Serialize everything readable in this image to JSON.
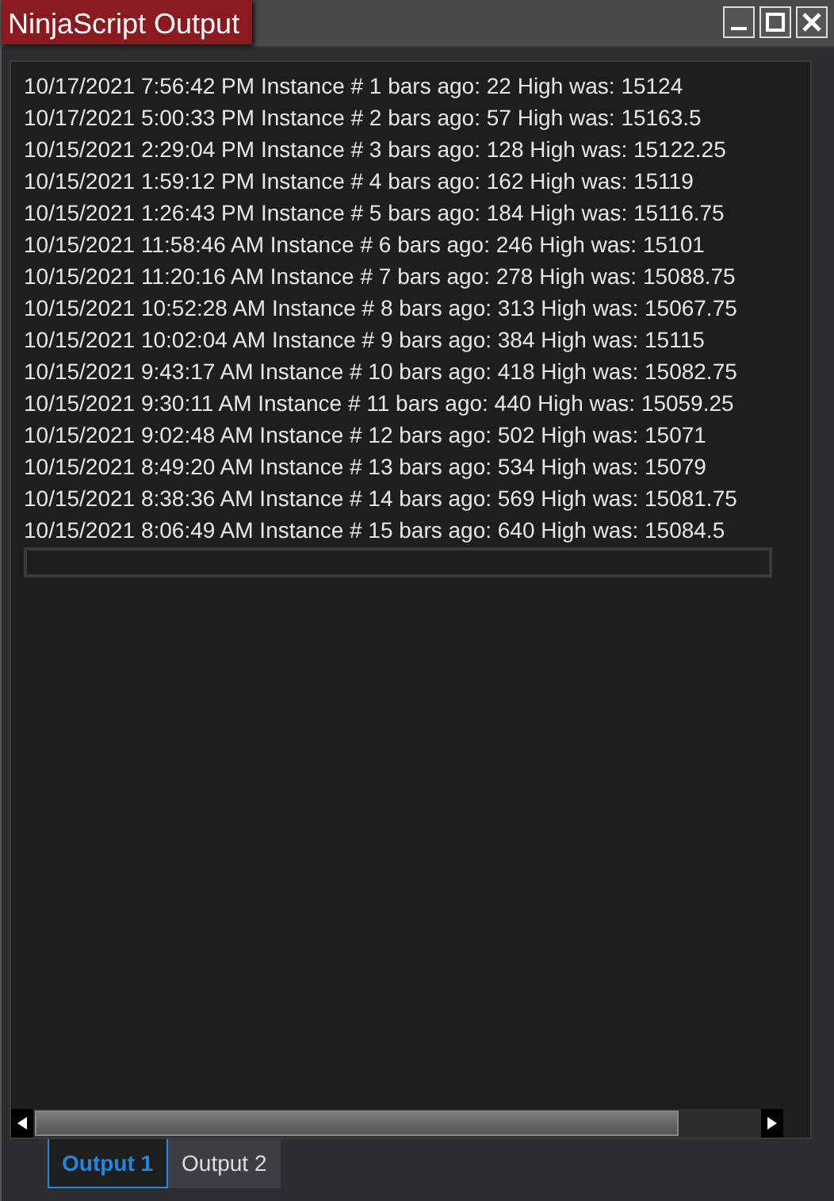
{
  "window": {
    "title": "NinjaScript Output"
  },
  "lines": [
    "10/17/2021 7:56:42 PM Instance # 1 bars ago: 22 High was: 15124",
    "10/17/2021 5:00:33 PM Instance # 2 bars ago: 57 High was: 15163.5",
    "10/15/2021 2:29:04 PM Instance # 3 bars ago: 128 High was: 15122.25",
    "10/15/2021 1:59:12 PM Instance # 4 bars ago: 162 High was: 15119",
    "10/15/2021 1:26:43 PM Instance # 5 bars ago: 184 High was: 15116.75",
    "10/15/2021 11:58:46 AM Instance # 6 bars ago: 246 High was: 15101",
    "10/15/2021 11:20:16 AM Instance # 7 bars ago: 278 High was: 15088.75",
    "10/15/2021 10:52:28 AM Instance # 8 bars ago: 313 High was: 15067.75",
    "10/15/2021 10:02:04 AM Instance # 9 bars ago: 384 High was: 15115",
    "10/15/2021 9:43:17 AM Instance # 10 bars ago: 418 High was: 15082.75",
    "10/15/2021 9:30:11 AM Instance # 11 bars ago: 440 High was: 15059.25",
    "10/15/2021 9:02:48 AM Instance # 12 bars ago: 502 High was: 15071",
    "10/15/2021 8:49:20 AM Instance # 13 bars ago: 534 High was: 15079",
    "10/15/2021 8:38:36 AM Instance # 14 bars ago: 569 High was: 15081.75",
    "10/15/2021 8:06:49 AM Instance # 15 bars ago: 640 High was: 15084.5"
  ],
  "tabs": [
    {
      "label": "Output 1",
      "selected": true
    },
    {
      "label": "Output 2",
      "selected": false
    }
  ]
}
